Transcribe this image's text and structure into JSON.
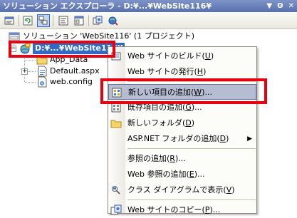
{
  "window": {
    "title": "ソリューション エクスプローラ - D:¥...¥WebSite116¥",
    "buttons": [
      "▼",
      "ʘ",
      "✕"
    ]
  },
  "toolbar": {
    "buttons": [
      "properties-icon",
      "refresh-icon",
      "nest-related-files-icon",
      "view-code-icon",
      "view-designer-icon",
      "copy-website-icon",
      "asp-net-config-icon"
    ]
  },
  "tree": {
    "solution_label": "ソリューション 'WebSite116' (1 プロジェクト)",
    "project_label": "D:¥...¥WebSite116¥",
    "items": [
      {
        "label": "App_Data",
        "icon": "folder-icon"
      },
      {
        "label": "Default.aspx",
        "icon": "aspx-file-icon"
      },
      {
        "label": "web.config",
        "icon": "config-file-icon"
      }
    ]
  },
  "context_menu": {
    "items": [
      {
        "label": "Web サイトのビルド",
        "key": "U",
        "icon": "build-icon"
      },
      {
        "label": "Web サイトの発行",
        "key": "H",
        "icon": ""
      },
      {
        "label": "新しい項目の追加",
        "key": "W",
        "suffix": "...",
        "icon": "new-item-icon",
        "highlighted": true
      },
      {
        "label": "既存項目の追加",
        "key": "G",
        "suffix": "...",
        "icon": "existing-item-icon"
      },
      {
        "label": "新しいフォルダ",
        "key": "D",
        "icon": "new-folder-icon"
      },
      {
        "label": "ASP.NET フォルダの追加",
        "key": "D",
        "icon": "",
        "submenu": true
      },
      {
        "label": "参照の追加",
        "key": "R",
        "suffix": "...",
        "icon": ""
      },
      {
        "label": "Web 参照の追加",
        "key": "E",
        "suffix": "...",
        "icon": ""
      },
      {
        "label": "クラス ダイアグラムで表示",
        "key": "V",
        "icon": "class-diagram-icon"
      },
      {
        "label": "Web サイトのコピー",
        "key": "P",
        "suffix": "...",
        "icon": "copy-website-icon"
      }
    ]
  },
  "colors": {
    "titlebar": "#6a80bc",
    "highlight": "#b6bdd2",
    "annotation": "#e60012",
    "selection": "#316ac5"
  }
}
